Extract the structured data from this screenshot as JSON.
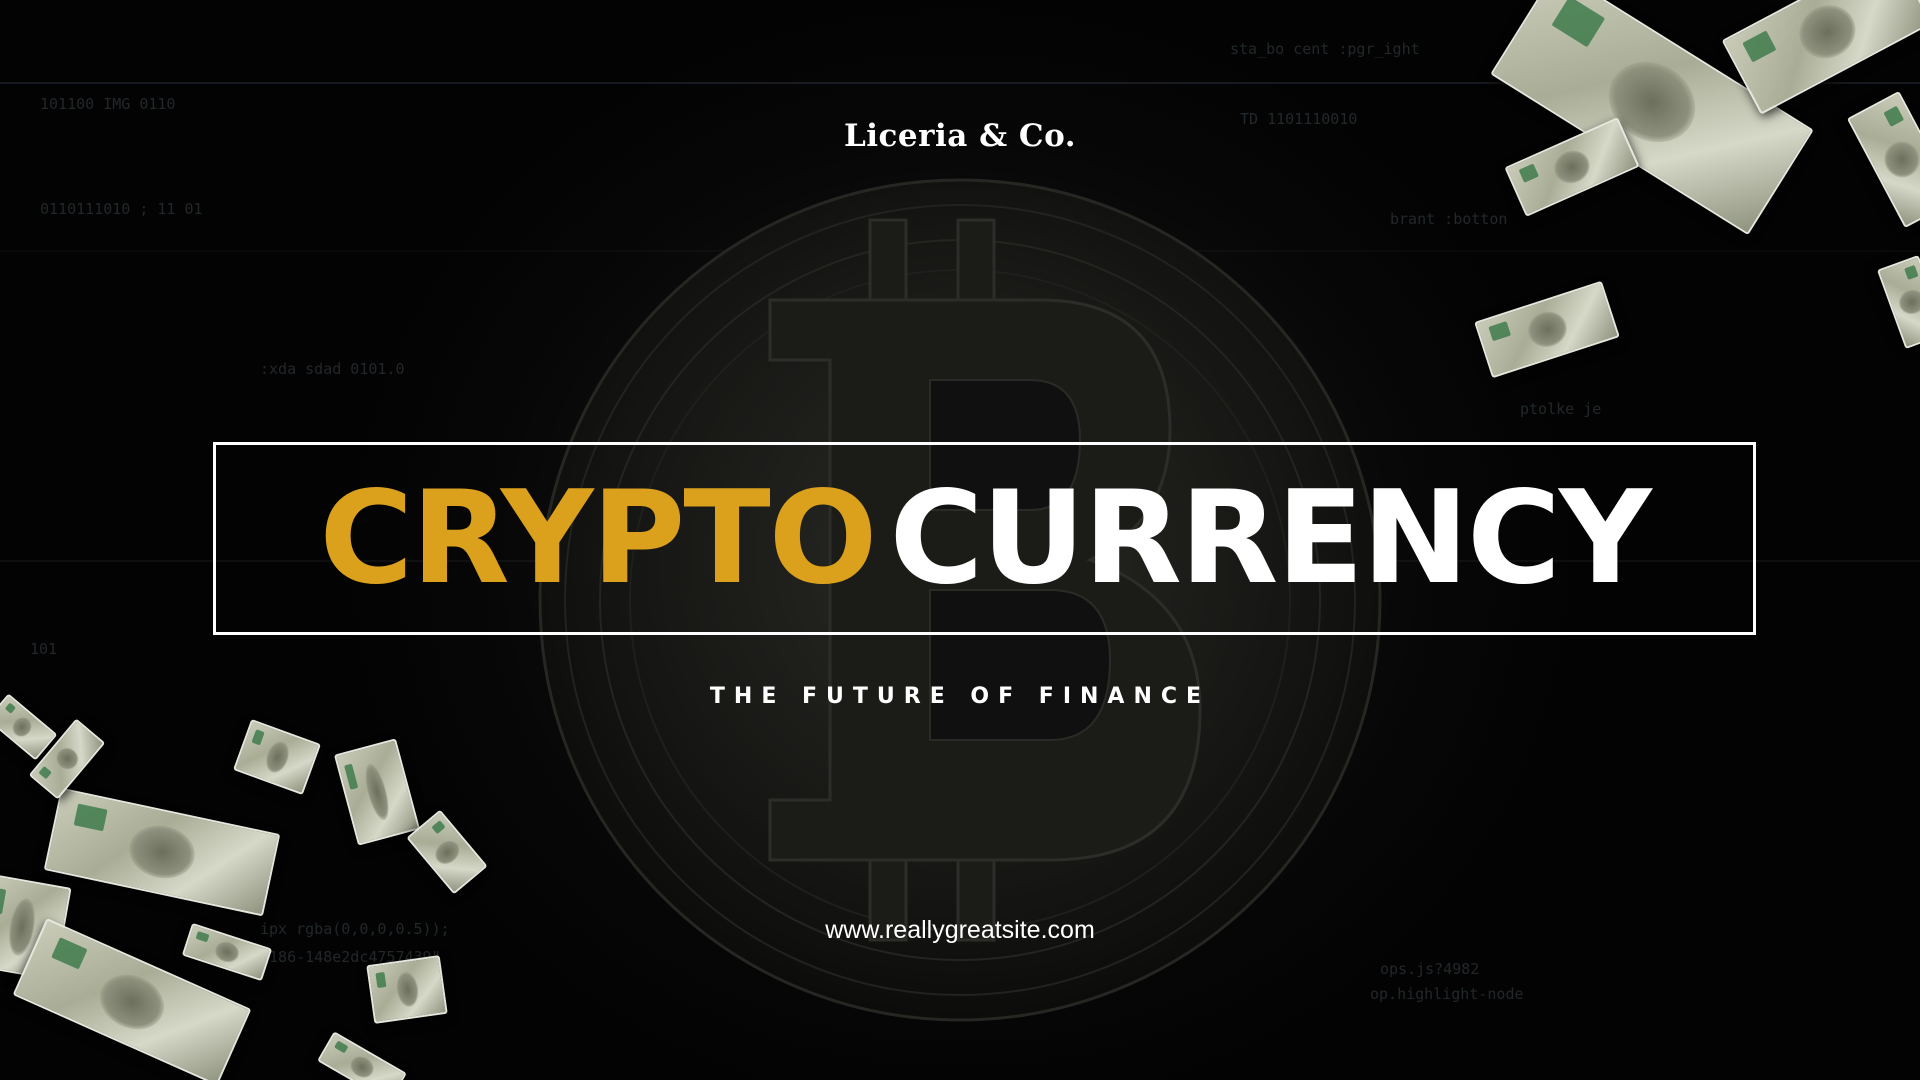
{
  "brand": "Liceria & Co.",
  "title": {
    "part1": "CRYPTO",
    "part2": "CURRENCY"
  },
  "tagline": "THE FUTURE OF FINANCE",
  "website": "www.reallygreatsite.com",
  "colors": {
    "accent": "#dba11c",
    "text": "#ffffff",
    "background": "#050505"
  },
  "background_icon": "bitcoin-coin-icon",
  "decoration_icon": "falling-dollar-bills"
}
